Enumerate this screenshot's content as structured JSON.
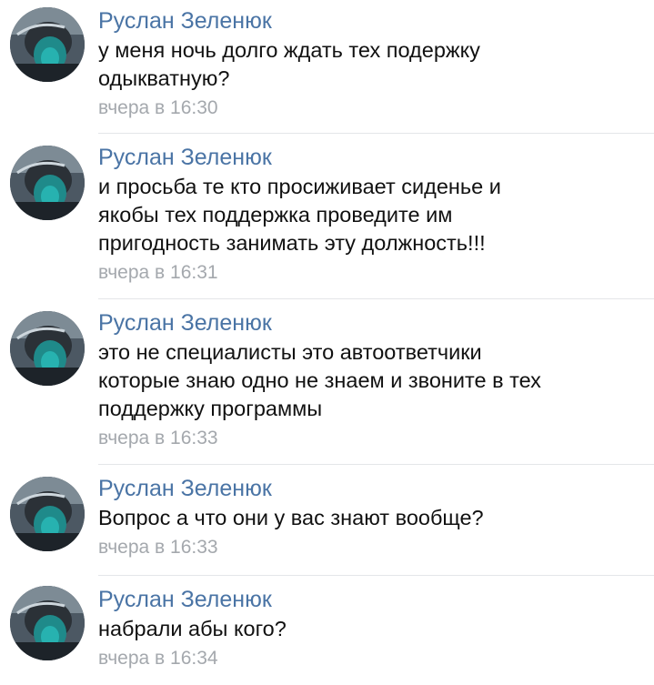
{
  "messages": [
    {
      "author": "Руслан Зеленюк",
      "lines": [
        "у меня ночь долго ждать тех подержку",
        "одыкватную?"
      ],
      "time": "вчера в 16:30"
    },
    {
      "author": "Руслан Зеленюк",
      "lines": [
        "и просьба те кто просиживает сиденье и",
        "якобы тех поддержка проведите им",
        "пригодность занимать эту должность!!!"
      ],
      "time": "вчера в 16:31"
    },
    {
      "author": "Руслан Зеленюк",
      "lines": [
        "это не специалисты это автоответчики",
        "которые знаю одно не знаем и звоните в тех",
        "поддержку программы"
      ],
      "time": "вчера в 16:33"
    },
    {
      "author": "Руслан Зеленюк",
      "lines": [
        "Вопрос а что они у вас знают вообще?"
      ],
      "time": "вчера в 16:33"
    },
    {
      "author": "Руслан Зеленюк",
      "lines": [
        "набрали абы кого?"
      ],
      "time": "вчера в 16:34"
    }
  ],
  "colors": {
    "author": "#4a74a5",
    "text": "#111111",
    "time": "#a4a8ad",
    "divider": "#e4e6e9"
  }
}
